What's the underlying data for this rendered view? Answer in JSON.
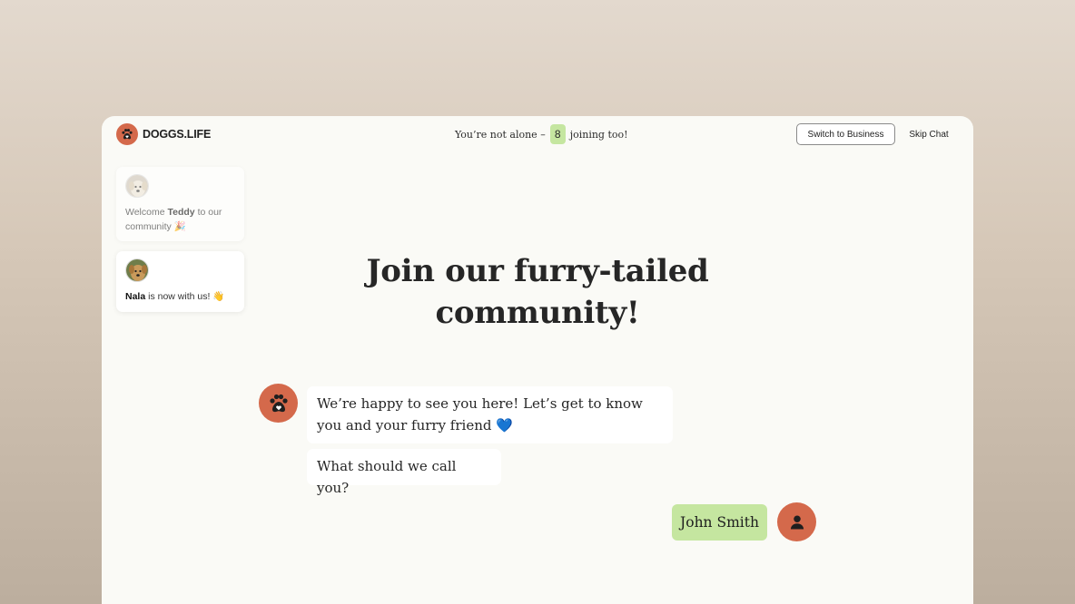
{
  "brand": {
    "name": "DOGGS.LIFE",
    "logo_icon": "paw-icon",
    "color": "#d4694b"
  },
  "notice": {
    "prefix": "You’re not alone –",
    "count": "8",
    "suffix": "joining too!",
    "count_color": "#c5e6a0"
  },
  "buttons": {
    "switch_business": "Switch to Business",
    "skip_chat": "Skip Chat"
  },
  "feed": [
    {
      "prefix": "Welcome ",
      "name": "Teddy",
      "suffix": " to our community 🎉",
      "avatar_icon": "dog-avatar-icon"
    },
    {
      "prefix": "",
      "name": "Nala",
      "suffix": " is now with us! 👋",
      "avatar_icon": "dog-avatar-icon"
    }
  ],
  "headline": "Join our furry-tailed community!",
  "chat": {
    "bot_icon": "paw-icon",
    "messages": [
      "We’re happy to see you here! Let’s get to know you and your furry friend 💙",
      "What should we call you?"
    ],
    "user_reply": "John Smith",
    "user_icon": "user-icon",
    "user_bubble_color": "#c5e6a0"
  }
}
